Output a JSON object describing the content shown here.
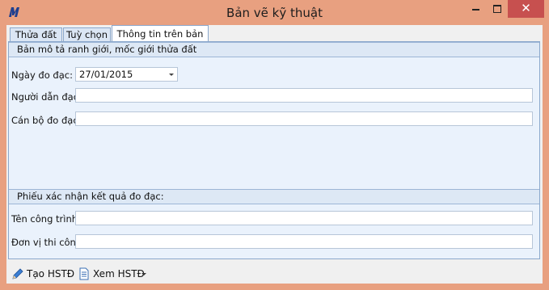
{
  "window": {
    "title": "Bản vẽ kỹ thuật",
    "close_symbol": "✕",
    "accent": "#e8a080",
    "close_color": "#c7504f"
  },
  "tabs": [
    {
      "label": "Thửa đất",
      "active": false
    },
    {
      "label": "Tuỳ chọn",
      "active": false
    },
    {
      "label": "Thông tin trên bản vẽ",
      "active": true
    }
  ],
  "group1": {
    "header": "Bản mô tả ranh giới, mốc giới thửa đất",
    "survey_date_label": "Ngày đo đạc:",
    "survey_date_value": "27/01/2015",
    "guide_label": "Người dẫn đạc:",
    "guide_value": "",
    "surveyor_label": "Cán bộ đo đạc:",
    "surveyor_value": ""
  },
  "group2": {
    "header": "Phiếu xác nhận kết quả đo đạc:",
    "project_label": "Tên công trình:",
    "project_value": "",
    "contractor_label": "Đơn vị thi công:",
    "contractor_value": ""
  },
  "toolbar": {
    "create_label": "Tạo HSTĐ",
    "create_icon": "pencil-icon",
    "view_label": "Xem HSTĐ",
    "view_icon": "document-icon"
  }
}
